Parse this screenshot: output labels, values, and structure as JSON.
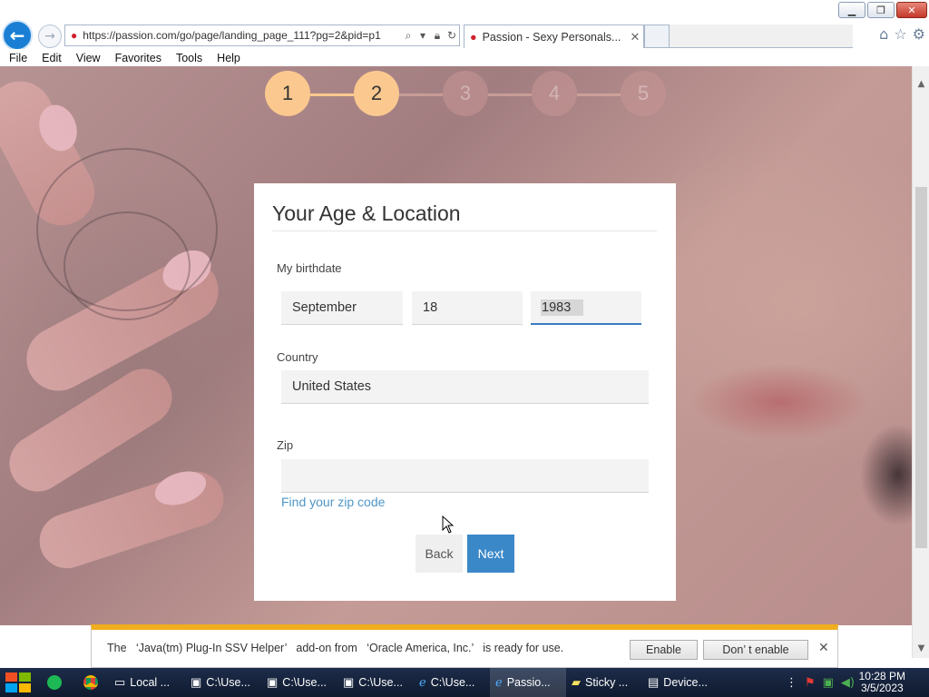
{
  "browser": {
    "url": "https://passion.com/go/page/landing_page_111?pg=2&pid=p1",
    "tab_title": "Passion - Sexy Personals...",
    "menu": [
      "File",
      "Edit",
      "View",
      "Favorites",
      "Tools",
      "Help"
    ]
  },
  "steps": [
    {
      "label": "1",
      "state": "done"
    },
    {
      "label": "2",
      "state": "done"
    },
    {
      "label": "3",
      "state": "todo"
    },
    {
      "label": "4",
      "state": "todo"
    },
    {
      "label": "5",
      "state": "todo"
    }
  ],
  "form": {
    "title": "Your Age & Location",
    "birthdate_label": "My birthdate",
    "month": "September",
    "day": "18",
    "year": "1983",
    "country_label": "Country",
    "country": "United States",
    "zip_label": "Zip",
    "zip_value": "",
    "zip_link": "Find your zip code",
    "back_label": "Back",
    "next_label": "Next"
  },
  "notification": {
    "message": "The   ‘Java(tm) Plug-In SSV Helper’   add-on from   ‘Oracle America, Inc.’   is ready for use.",
    "enable_label": "Enable",
    "dont_enable_label": "Don’ t enable"
  },
  "taskbar": {
    "items": [
      "Local ...",
      "C:\\Use...",
      "C:\\Use...",
      "C:\\Use...",
      "C:\\Use...",
      "Passio...",
      "Sticky ...",
      "Device..."
    ],
    "time": "10:28 PM",
    "date": "3/5/2023"
  },
  "colors": {
    "accent": "#3b88c8",
    "step_done": "#fbc98f",
    "link": "#4f96c7",
    "notify_bar": "#f0ad1d"
  }
}
